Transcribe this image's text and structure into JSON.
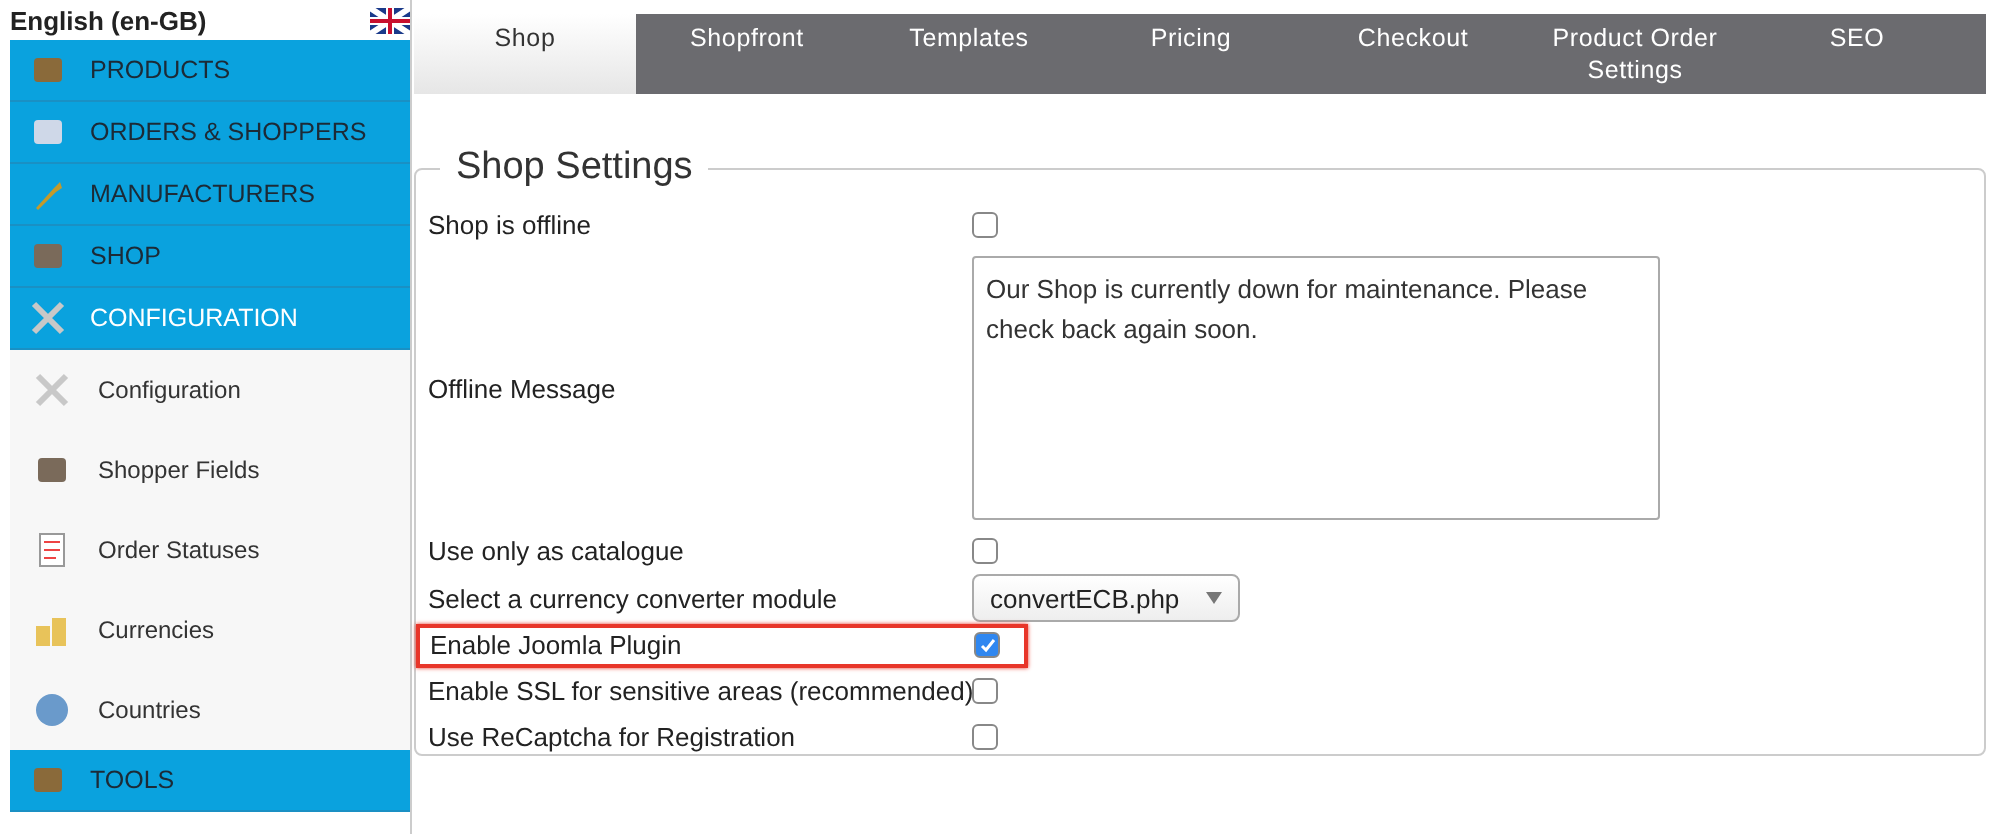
{
  "language": {
    "label": "English (en-GB)"
  },
  "sidebar": {
    "sections": [
      {
        "label": "PRODUCTS",
        "expanded": false
      },
      {
        "label": "ORDERS & SHOPPERS",
        "expanded": false
      },
      {
        "label": "MANUFACTURERS",
        "expanded": false
      },
      {
        "label": "SHOP",
        "expanded": false
      },
      {
        "label": "CONFIGURATION",
        "expanded": true,
        "children": [
          {
            "label": "Configuration"
          },
          {
            "label": "Shopper Fields"
          },
          {
            "label": "Order Statuses"
          },
          {
            "label": "Currencies"
          },
          {
            "label": "Countries"
          }
        ]
      },
      {
        "label": "TOOLS",
        "expanded": false
      }
    ]
  },
  "tabs": [
    {
      "label": "Shop",
      "selected": true
    },
    {
      "label": "Shopfront",
      "selected": false
    },
    {
      "label": "Templates",
      "selected": false
    },
    {
      "label": "Pricing",
      "selected": false
    },
    {
      "label": "Checkout",
      "selected": false
    },
    {
      "label": "Product Order Settings",
      "selected": false
    },
    {
      "label": "SEO",
      "selected": false
    }
  ],
  "panel": {
    "title": "Shop Settings",
    "rows": [
      {
        "kind": "checkbox",
        "label": "Shop is offline",
        "checked": false,
        "highlighted": false
      },
      {
        "kind": "textarea",
        "label": "Offline Message",
        "value": "Our Shop is currently down for maintenance. Please check back again soon.",
        "highlighted": false
      },
      {
        "kind": "checkbox",
        "label": "Use only as catalogue",
        "checked": false,
        "highlighted": false
      },
      {
        "kind": "select",
        "label": "Select a currency converter module",
        "value": "convertECB.php",
        "highlighted": false
      },
      {
        "kind": "checkbox",
        "label": "Enable Joomla Plugin",
        "checked": true,
        "highlighted": true
      },
      {
        "kind": "checkbox",
        "label": "Enable SSL for sensitive areas (recommended)",
        "checked": false,
        "highlighted": false
      },
      {
        "kind": "checkbox",
        "label": "Use ReCaptcha for Registration",
        "checked": false,
        "highlighted": false
      }
    ]
  }
}
